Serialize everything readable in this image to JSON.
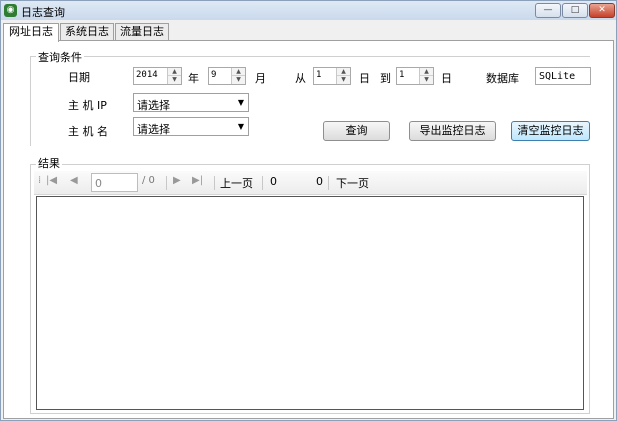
{
  "window": {
    "title": "日志查询",
    "icon_name": "app-icon",
    "buttons": {
      "minimize": "—",
      "maximize": "□",
      "close": "✕"
    }
  },
  "tabs": [
    {
      "label": "网址日志",
      "active": true
    },
    {
      "label": "系统日志",
      "active": false
    },
    {
      "label": "流量日志",
      "active": false
    }
  ],
  "query": {
    "group_title": "查询条件",
    "date_label": "日期",
    "year_value": "2014",
    "year_unit": "年",
    "month_value": "9",
    "month_unit": "月",
    "from_label": "从",
    "day_from_value": "1",
    "day_unit_1": "日",
    "to_label": "到",
    "day_to_value": "1",
    "day_unit_2": "日",
    "db_label": "数据库",
    "db_value": "SQLite",
    "host_ip_label": "主 机 IP",
    "host_ip_value": "请选择",
    "host_name_label": "主 机 名",
    "host_name_value": "请选择",
    "query_button": "查询",
    "export_button": "导出监控日志",
    "clear_button": "清空监控日志"
  },
  "results": {
    "group_title": "结果",
    "page_input": "0",
    "page_total": "/ 0",
    "prev_page": "上一页",
    "count_a": "0",
    "count_b": "0",
    "next_page": "下一页"
  }
}
